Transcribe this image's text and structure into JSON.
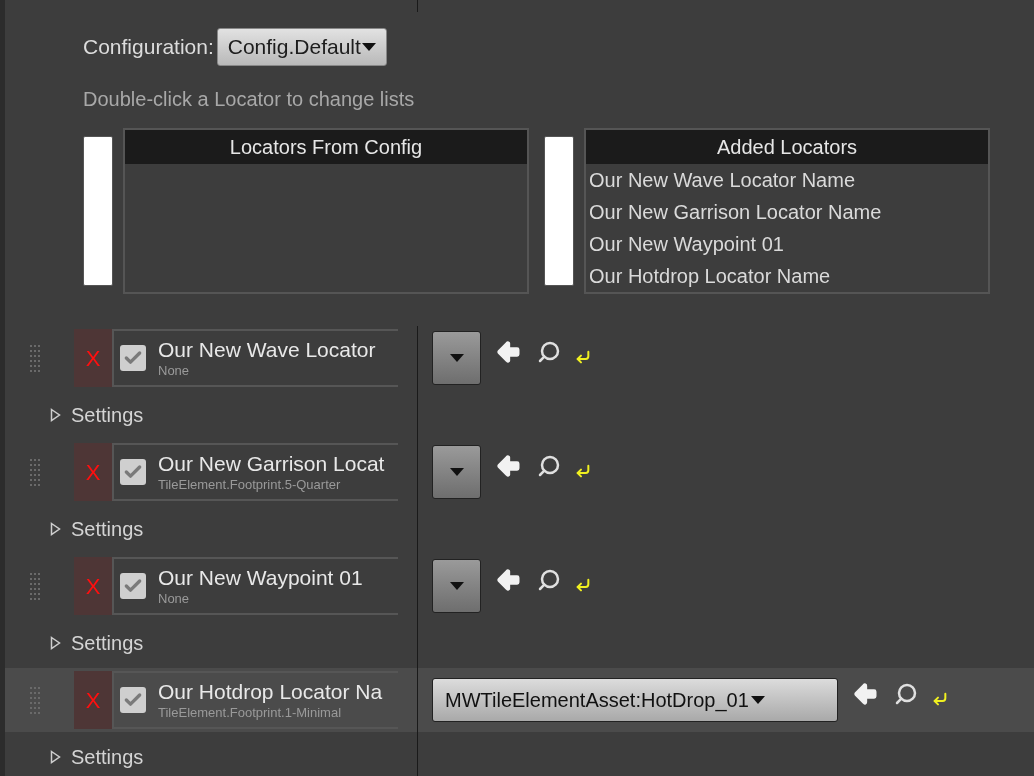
{
  "configuration": {
    "label": "Configuration:",
    "value": "Config.Default"
  },
  "hint": "Double-click a Locator to change lists",
  "lists": [
    {
      "title": "Locators From Config"
    },
    {
      "title": "Added Locators",
      "entries": [
        "Our New Wave Locator Name",
        "Our New Garrison Locator Name",
        "Our New Waypoint 01",
        "Our Hotdrop Locator Name"
      ]
    }
  ],
  "items": [
    {
      "remove": "X",
      "checked": true,
      "name": "Our New Wave Locator",
      "detail": "None",
      "highlighted": false,
      "settings": {
        "label": "Settings",
        "expanded": false
      }
    },
    {
      "remove": "X",
      "checked": true,
      "name": "Our New Garrison Locat",
      "detail": "TileElement.Footprint.5-Quarter",
      "highlighted": false,
      "settings": {
        "label": "Settings",
        "expanded": false
      }
    },
    {
      "remove": "X",
      "checked": true,
      "name": "Our New Waypoint 01",
      "detail": "None",
      "highlighted": false,
      "settings": {
        "label": "Settings",
        "expanded": false
      }
    },
    {
      "remove": "X",
      "checked": true,
      "name": "Our Hotdrop Locator Na",
      "detail": "TileElement.Footprint.1-Minimal",
      "asset": "MWTileElementAsset:HotDrop_01",
      "highlighted": true,
      "settings": {
        "label": "Settings",
        "expanded": false
      }
    }
  ]
}
